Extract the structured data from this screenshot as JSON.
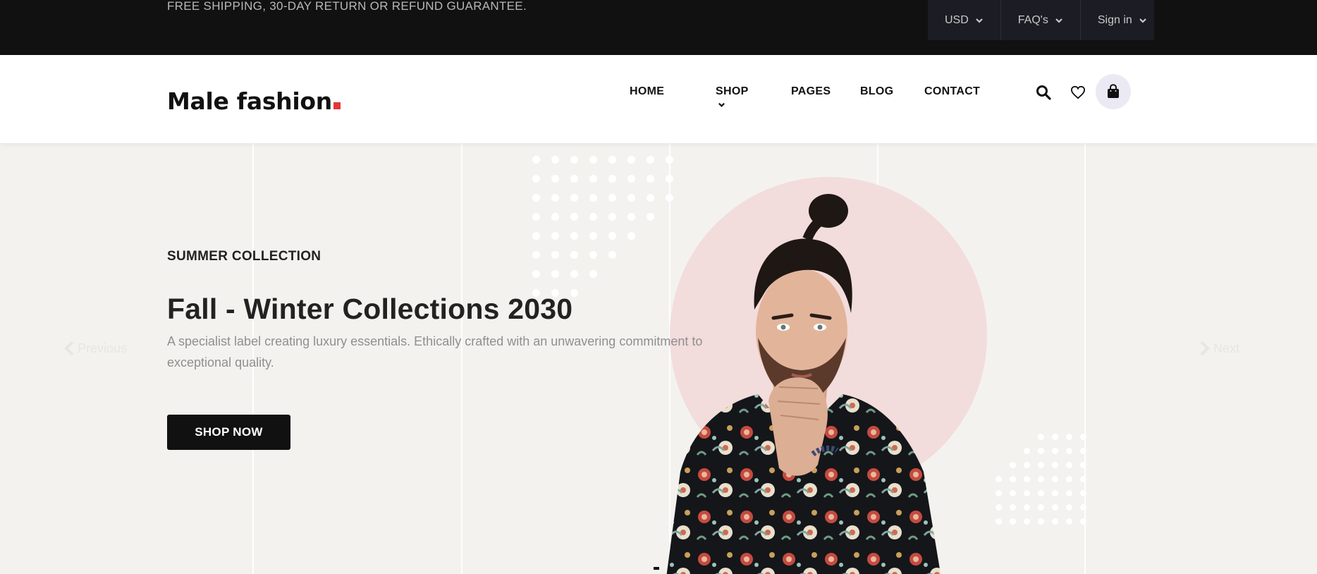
{
  "topbar": {
    "announcement": "FREE SHIPPING, 30-DAY RETURN OR REFUND GUARANTEE.",
    "currency": "USD",
    "faq": "FAQ's",
    "signin": "Sign in"
  },
  "header": {
    "logo_text": "Male fashion",
    "nav": {
      "home": "HOME",
      "shop": "SHOP",
      "pages": "PAGES",
      "blog": "BLOG",
      "contact": "CONTACT"
    },
    "icons": [
      "search-icon",
      "heart-icon",
      "shopping-bag-icon"
    ]
  },
  "hero": {
    "subtitle": "SUMMER COLLECTION",
    "title": "Fall - Winter Collections 2030",
    "description": "A specialist label creating luxury essentials. Ethically crafted with an unwavering commitment to exceptional quality.",
    "button": "SHOP NOW",
    "prev": "Previous",
    "next": "Next"
  },
  "colors": {
    "topbar_bg": "#111111",
    "hero_bg": "#f3f2ee",
    "accent_red": "#e53637",
    "pink_circle": "#f2dcdc"
  }
}
